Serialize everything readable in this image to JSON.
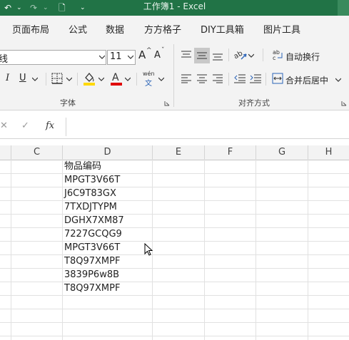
{
  "titlebar": {
    "title": "工作簿1  -  Excel",
    "qat_items": [
      "↶",
      "⌄",
      "↷",
      "⌄",
      "🗋",
      "⌄"
    ]
  },
  "menu": [
    "页面布局",
    "公式",
    "数据",
    "方方格子",
    "DIY工具箱",
    "图片工具"
  ],
  "ribbon": {
    "font_name_partial": "线",
    "font_size": "11",
    "grow_font": "A",
    "shrink_font": "A",
    "italic": "I",
    "underline": "U",
    "pinyin_top": "wén",
    "pinyin_bottom": "文",
    "font_group_label": "字体",
    "align_group_label": "对齐方式",
    "wrap_text": "自动换行",
    "merge_center": "合并后居中"
  },
  "formula_bar": {
    "cancel": "✕",
    "confirm": "✓",
    "fx": "fx",
    "value": ""
  },
  "columns": [
    "C",
    "D",
    "E",
    "F",
    "G",
    "H"
  ],
  "cells": {
    "header": "物品编码",
    "values": [
      "MPGT3V66T",
      "J6C9T83GX",
      "7TXDJTYPM",
      "DGHX7XM87",
      "7227GCQG9",
      "MPGT3V66T",
      "T8Q97XMPF",
      "3839P6w8B",
      "T8Q97XMPF"
    ]
  },
  "colors": {
    "excel_green": "#217346",
    "highlight_yellow": "#ffd800",
    "font_red": "#e00000"
  }
}
